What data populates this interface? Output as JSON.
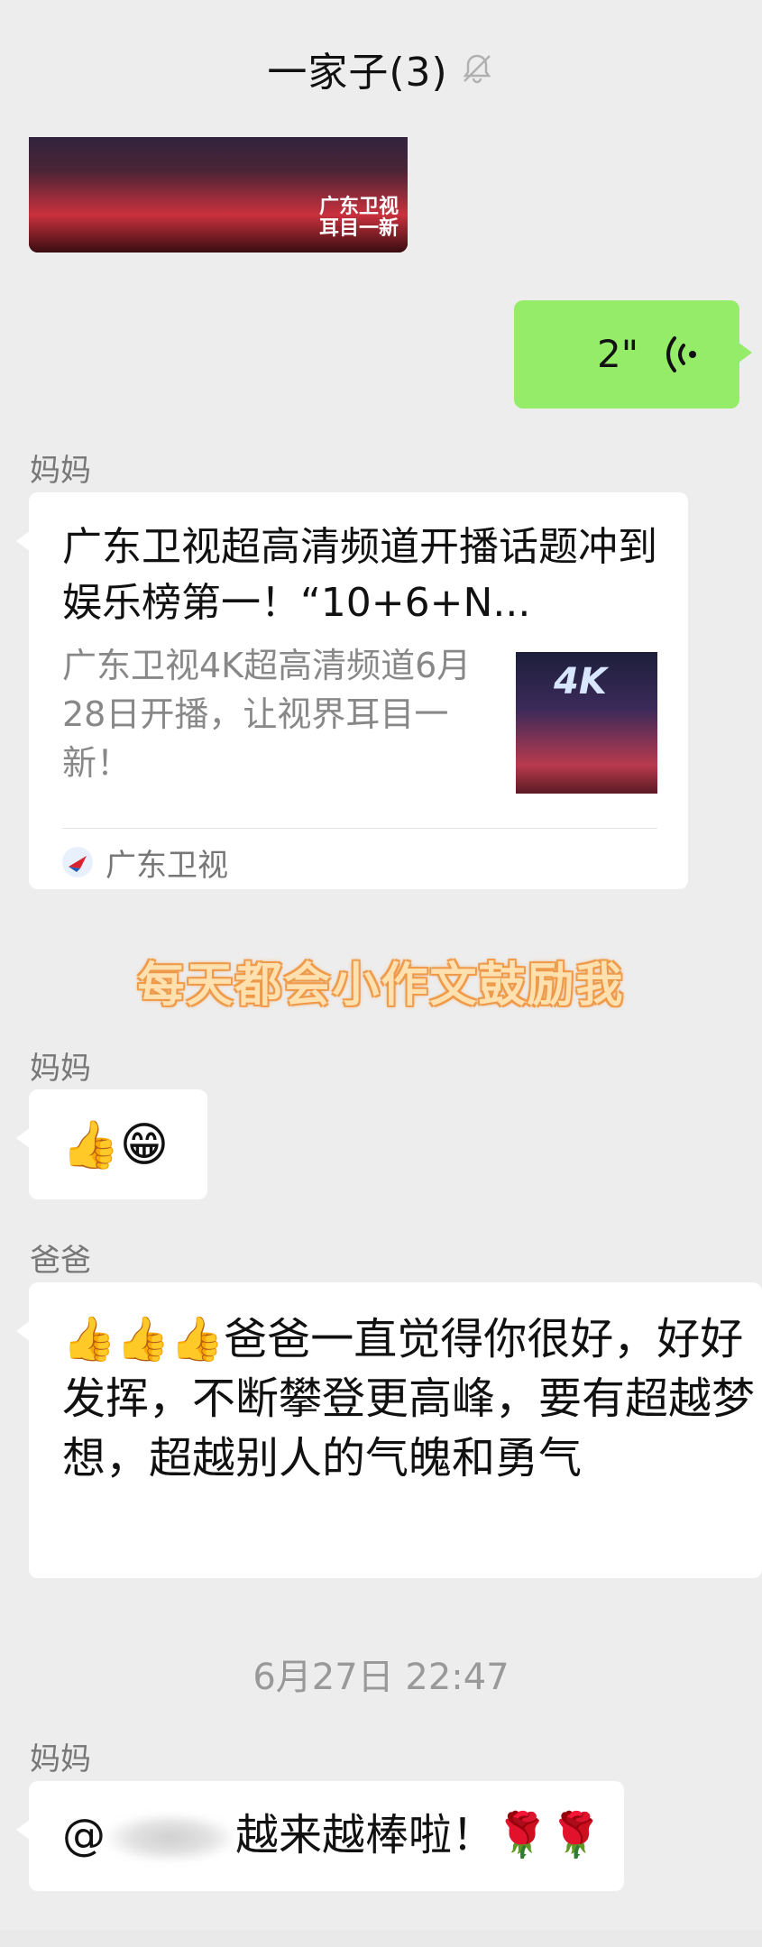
{
  "header": {
    "title": "一家子(3)",
    "mute_icon": "bell-slash-icon"
  },
  "image_message": {
    "caption_line1": "广东卫视",
    "caption_line2": "耳目一新"
  },
  "voice_message": {
    "duration": "2\""
  },
  "messages": [
    {
      "sender": "妈妈"
    },
    {
      "sender": "妈妈",
      "emoji": "👍😁"
    },
    {
      "sender": "爸爸",
      "text": "👍👍👍爸爸一直觉得你很好，好好发挥，不断攀登更高峰，要有超越梦想，超越别人的气魄和勇气"
    },
    {
      "sender": "妈妈",
      "prefix": "@",
      "suffix": "越来越棒啦！🌹🌹"
    }
  ],
  "link_card": {
    "title": "广东卫视超高清频道开播话题冲到娱乐榜第一！“10+6+N...",
    "description": "广东卫视4K超高清频道6月28日开播，让视界耳目一新！",
    "thumb_label": "4K",
    "source": "广东卫视",
    "source_icon": "guangdong-tv-logo-icon"
  },
  "overlay_caption": "每天都会小作文鼓励我",
  "timestamp": "6月27日 22:47"
}
